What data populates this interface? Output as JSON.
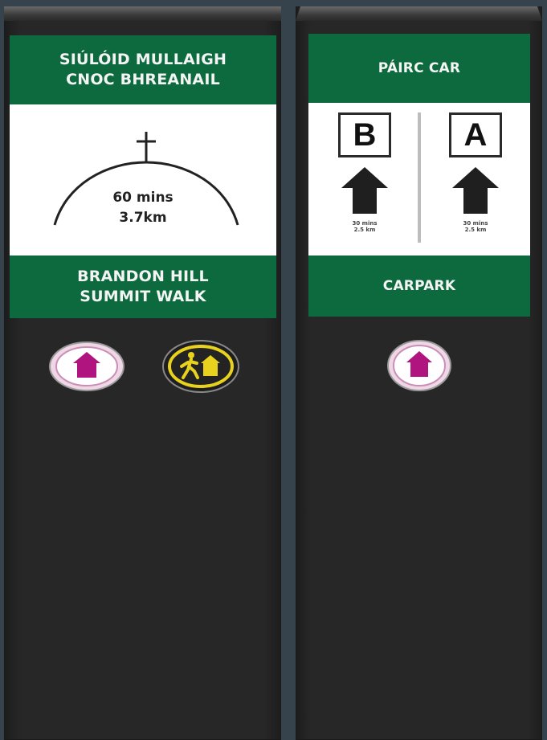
{
  "left_sign": {
    "top_band": [
      "SIÚLÓID MULLAIGH",
      "CNOC BHREANAIL"
    ],
    "duration": "60 mins",
    "distance": "3.7km",
    "bottom_band": [
      "BRANDON HILL",
      "SUMMIT WALK"
    ]
  },
  "right_sign": {
    "top_band": "PÁIRC CAR",
    "routes": [
      {
        "letter": "B",
        "time": "30 mins",
        "distance": "2.5 km"
      },
      {
        "letter": "A",
        "time": "30 mins",
        "distance": "2.5 km"
      }
    ],
    "bottom_band": "CARPARK"
  },
  "colors": {
    "band_green": "#0d6a3e",
    "post_black": "#272727",
    "background": "#37434c",
    "badge_magenta": "#b0157f",
    "badge_yellow": "#e8d21d"
  },
  "icons": {
    "left": [
      "home-waymarker-icon",
      "walker-waymarker-icon"
    ],
    "right": [
      "home-waymarker-icon"
    ]
  }
}
